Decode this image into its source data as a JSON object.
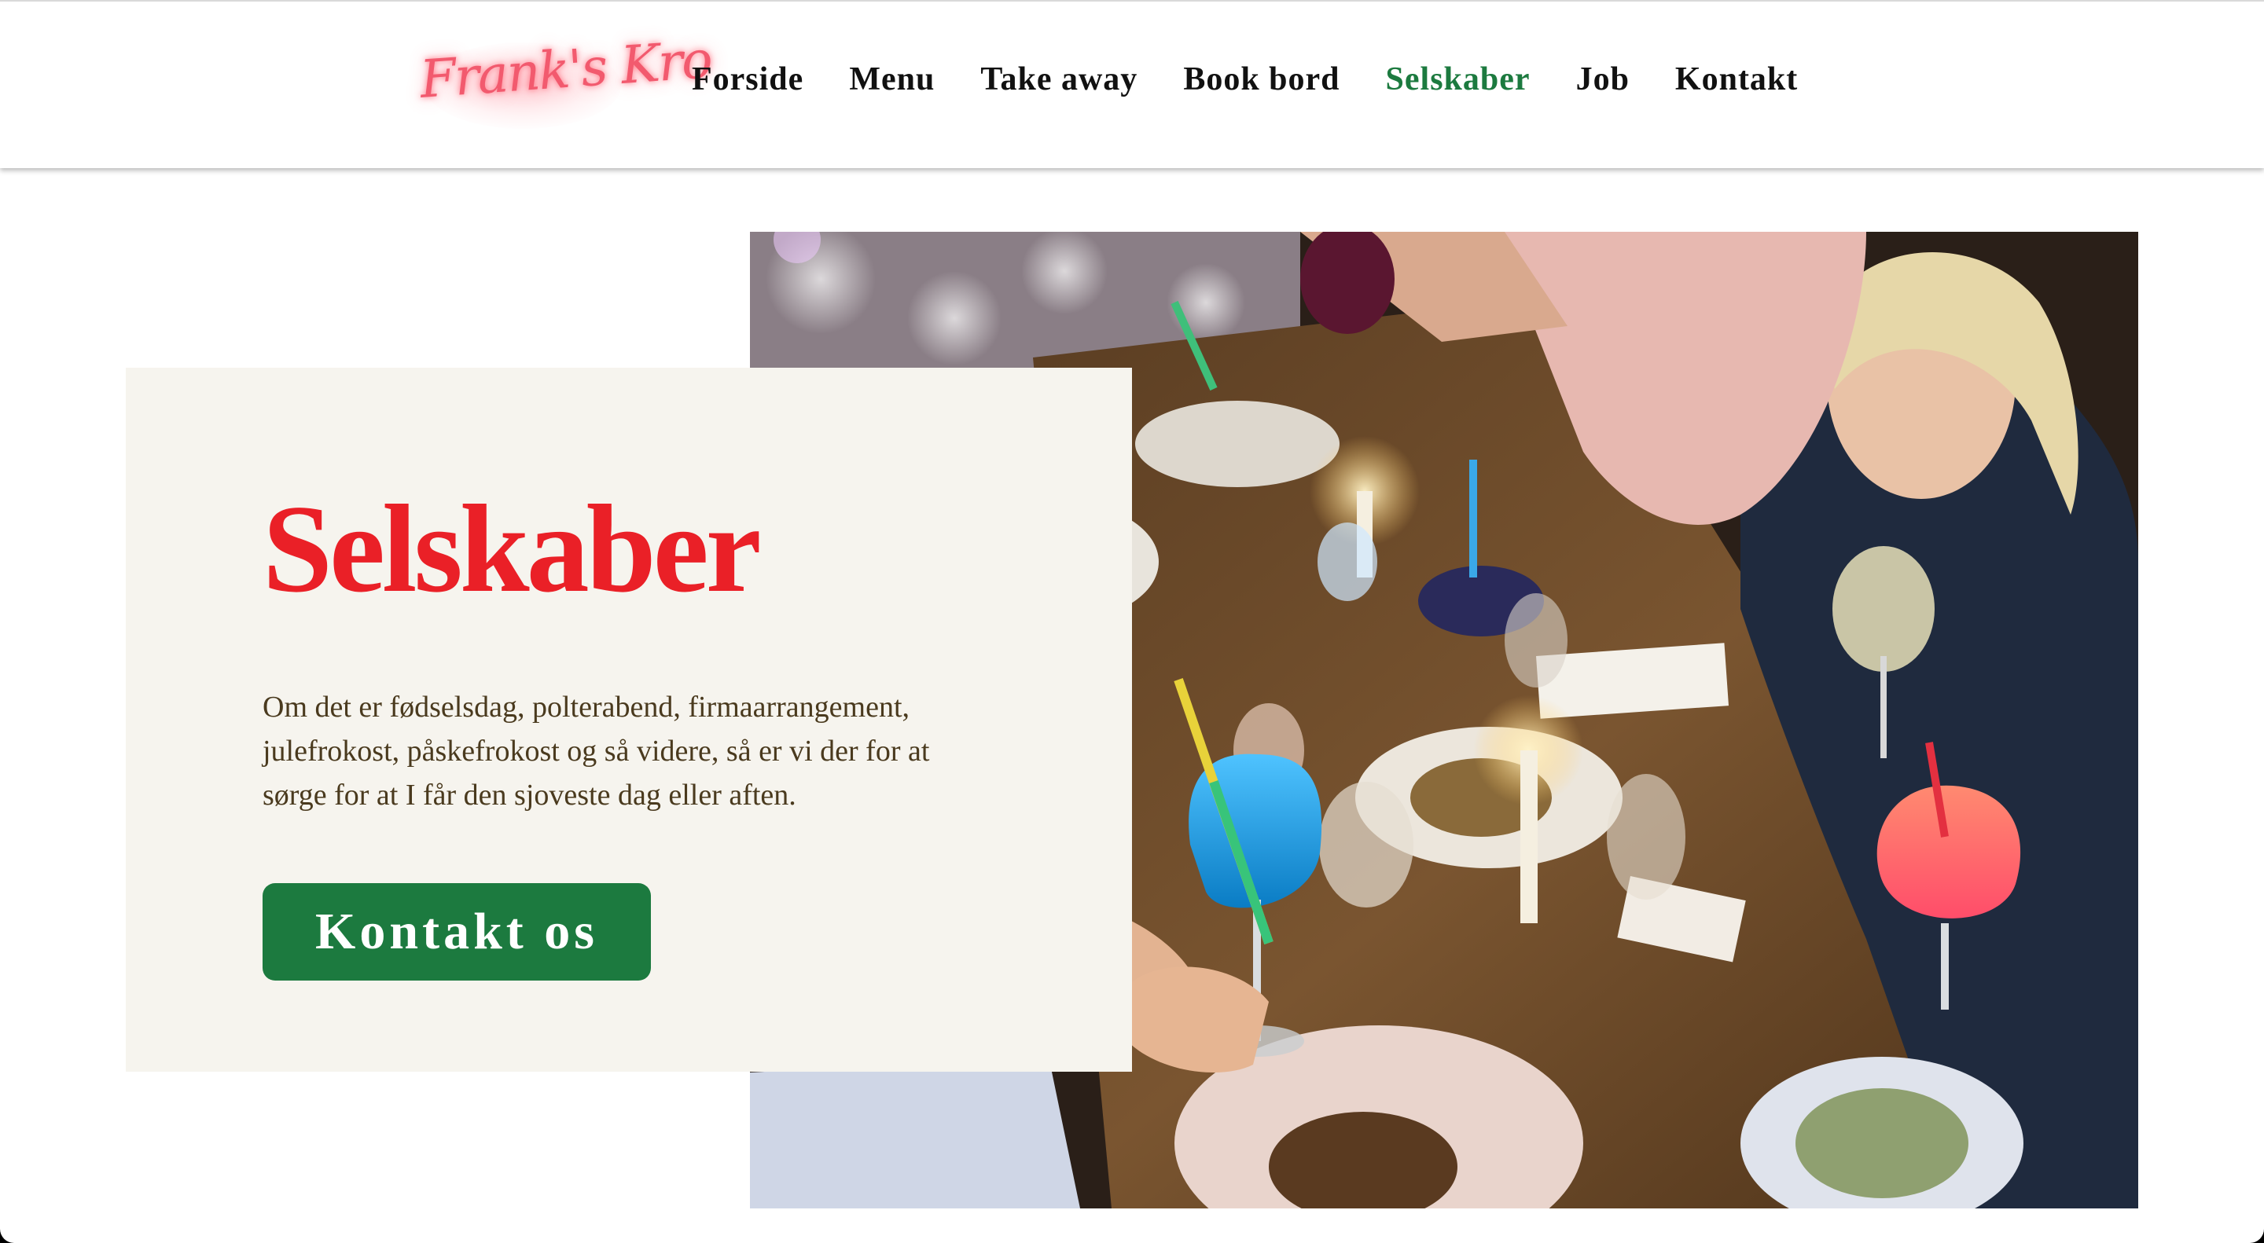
{
  "header": {
    "logo_text": "Frank's Kro",
    "nav": [
      {
        "label": "Forside",
        "active": false
      },
      {
        "label": "Menu",
        "active": false
      },
      {
        "label": "Take away",
        "active": false
      },
      {
        "label": "Book bord",
        "active": false
      },
      {
        "label": "Selskaber",
        "active": true
      },
      {
        "label": "Job",
        "active": false
      },
      {
        "label": "Kontakt",
        "active": false
      }
    ]
  },
  "hero": {
    "title": "Selskaber",
    "description": "Om det er fødselsdag, polterabend, firmaarrangement, julefrokost, påskefrokost og så videre, så er vi der for at sørge for at I får den sjoveste dag eller aften.",
    "button_label": "Kontakt os",
    "image_subject": "party dinner table with drinks, candles and guests toasting"
  },
  "colors": {
    "accent_green": "#1c7a3f",
    "title_red": "#ea2027",
    "card_background": "#f6f4ee",
    "body_text": "#4a3a1e",
    "logo_pink": "#f25a6e"
  }
}
